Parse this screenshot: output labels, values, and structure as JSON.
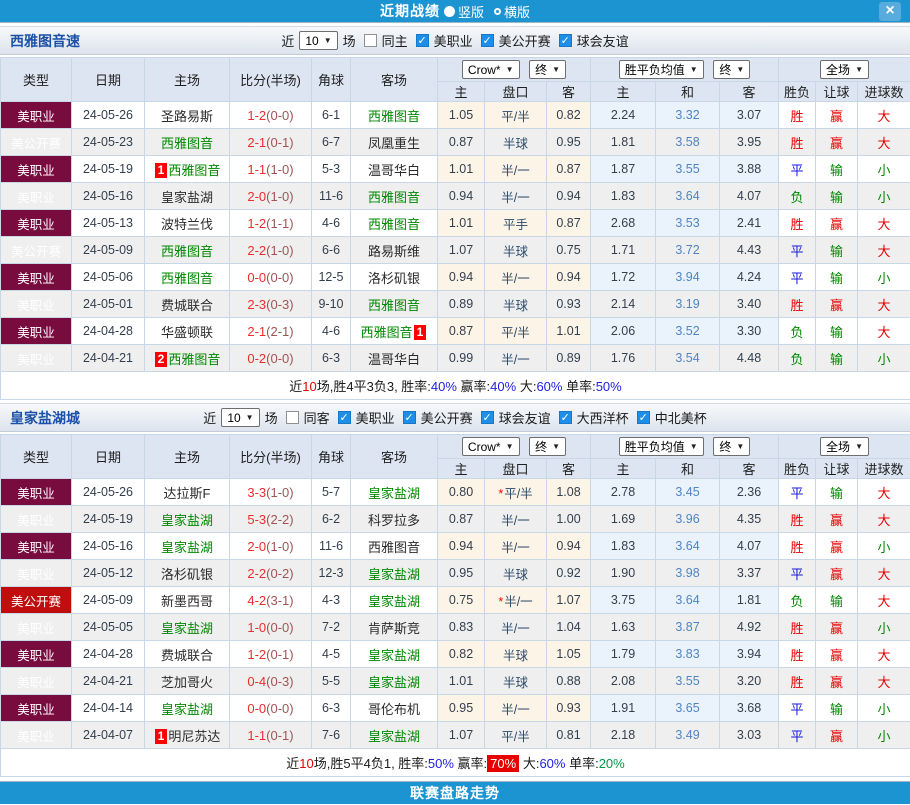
{
  "topbar": {
    "title": "近期战绩",
    "radios": [
      {
        "label": "竖版",
        "selected": true
      },
      {
        "label": "横版",
        "selected": false
      }
    ],
    "close": "×"
  },
  "header_labels": {
    "cols": [
      "类型",
      "日期",
      "主场",
      "比分(半场)",
      "角球",
      "客场"
    ],
    "sub": [
      "主",
      "盘口",
      "客",
      "主",
      "和",
      "客",
      "胜负",
      "让球",
      "进球数"
    ],
    "selects": {
      "crow": "Crow*",
      "final": "终",
      "avg": "胜平负均值",
      "scope": "全场"
    }
  },
  "legend_colors": {
    "胜": "cr",
    "平": "cbl",
    "负": "cg",
    "赢": "cr",
    "输": "cg",
    "大": "cr",
    "小": "cg"
  },
  "accent_colors": {
    "topbar": "#1d94d2",
    "mls": "#780c3f",
    "usoc": "#c00d0d",
    "focus_team": "#008800",
    "highlight": "#e60000"
  },
  "sections": [
    {
      "team": "西雅图音速",
      "filter": {
        "near": "近",
        "count": "10",
        "games": "场",
        "same": {
          "label": "同主",
          "checked": false
        },
        "leagues": [
          {
            "label": "美职业",
            "checked": true
          },
          {
            "label": "美公开赛",
            "checked": true
          },
          {
            "label": "球会友谊",
            "checked": true
          }
        ]
      },
      "rows": [
        {
          "league": "美职业",
          "lc": "mls",
          "date": "24-05-26",
          "home": {
            "name": "圣路易斯"
          },
          "score": {
            "ft": "1-2",
            "ht": "(0-0)"
          },
          "corners": "6-1",
          "away": {
            "name": "西雅图音",
            "focus": true
          },
          "asian": {
            "home": "1.05",
            "line": "平/半",
            "away": "0.82"
          },
          "avg": {
            "home": "2.24",
            "draw": "3.32",
            "away": "3.07"
          },
          "result": {
            "outcome": "胜",
            "handicap": "赢",
            "goals": "大"
          }
        },
        {
          "league": "美公开赛",
          "lc": "usoc",
          "date": "24-05-23",
          "home": {
            "name": "西雅图音",
            "focus": true
          },
          "score": {
            "ft": "2-1",
            "ht": "(0-1)"
          },
          "corners": "6-7",
          "away": {
            "name": "凤凰重生"
          },
          "asian": {
            "home": "0.87",
            "line": "半球",
            "away": "0.95"
          },
          "avg": {
            "home": "1.81",
            "draw": "3.58",
            "away": "3.95"
          },
          "result": {
            "outcome": "胜",
            "handicap": "赢",
            "goals": "大"
          }
        },
        {
          "league": "美职业",
          "lc": "mls",
          "date": "24-05-19",
          "home": {
            "name": "西雅图音",
            "focus": true,
            "badge": "1",
            "badge_pos": "before"
          },
          "score": {
            "ft": "1-1",
            "ht": "(1-0)"
          },
          "corners": "5-3",
          "away": {
            "name": "温哥华白"
          },
          "asian": {
            "home": "1.01",
            "line": "半/一",
            "away": "0.87"
          },
          "avg": {
            "home": "1.87",
            "draw": "3.55",
            "away": "3.88"
          },
          "result": {
            "outcome": "平",
            "handicap": "输",
            "goals": "小"
          }
        },
        {
          "league": "美职业",
          "lc": "mls",
          "date": "24-05-16",
          "home": {
            "name": "皇家盐湖"
          },
          "score": {
            "ft": "2-0",
            "ht": "(1-0)"
          },
          "corners": "11-6",
          "away": {
            "name": "西雅图音",
            "focus": true
          },
          "asian": {
            "home": "0.94",
            "line": "半/一",
            "away": "0.94"
          },
          "avg": {
            "home": "1.83",
            "draw": "3.64",
            "away": "4.07"
          },
          "result": {
            "outcome": "负",
            "handicap": "输",
            "goals": "小"
          }
        },
        {
          "league": "美职业",
          "lc": "mls",
          "date": "24-05-13",
          "home": {
            "name": "波特兰伐"
          },
          "score": {
            "ft": "1-2",
            "ht": "(1-1)"
          },
          "corners": "4-6",
          "away": {
            "name": "西雅图音",
            "focus": true
          },
          "asian": {
            "home": "1.01",
            "line": "平手",
            "away": "0.87"
          },
          "avg": {
            "home": "2.68",
            "draw": "3.53",
            "away": "2.41"
          },
          "result": {
            "outcome": "胜",
            "handicap": "赢",
            "goals": "大"
          }
        },
        {
          "league": "美公开赛",
          "lc": "usoc",
          "date": "24-05-09",
          "home": {
            "name": "西雅图音",
            "focus": true
          },
          "score": {
            "ft": "2-2",
            "ht": "(1-0)"
          },
          "corners": "6-6",
          "away": {
            "name": "路易斯维"
          },
          "asian": {
            "home": "1.07",
            "line": "半球",
            "away": "0.75"
          },
          "avg": {
            "home": "1.71",
            "draw": "3.72",
            "away": "4.43"
          },
          "result": {
            "outcome": "平",
            "handicap": "输",
            "goals": "大"
          }
        },
        {
          "league": "美职业",
          "lc": "mls",
          "date": "24-05-06",
          "home": {
            "name": "西雅图音",
            "focus": true
          },
          "score": {
            "ft": "0-0",
            "ht": "(0-0)"
          },
          "corners": "12-5",
          "away": {
            "name": "洛杉矶银"
          },
          "asian": {
            "home": "0.94",
            "line": "半/一",
            "away": "0.94"
          },
          "avg": {
            "home": "1.72",
            "draw": "3.94",
            "away": "4.24"
          },
          "result": {
            "outcome": "平",
            "handicap": "输",
            "goals": "小"
          }
        },
        {
          "league": "美职业",
          "lc": "mls",
          "date": "24-05-01",
          "home": {
            "name": "费城联合"
          },
          "score": {
            "ft": "2-3",
            "ht": "(0-3)"
          },
          "corners": "9-10",
          "away": {
            "name": "西雅图音",
            "focus": true
          },
          "asian": {
            "home": "0.89",
            "line": "半球",
            "away": "0.93"
          },
          "avg": {
            "home": "2.14",
            "draw": "3.19",
            "away": "3.40"
          },
          "result": {
            "outcome": "胜",
            "handicap": "赢",
            "goals": "大"
          }
        },
        {
          "league": "美职业",
          "lc": "mls",
          "date": "24-04-28",
          "home": {
            "name": "华盛顿联"
          },
          "score": {
            "ft": "2-1",
            "ht": "(2-1)"
          },
          "corners": "4-6",
          "away": {
            "name": "西雅图音",
            "focus": true,
            "badge": "1",
            "badge_pos": "after"
          },
          "asian": {
            "home": "0.87",
            "line": "平/半",
            "away": "1.01"
          },
          "avg": {
            "home": "2.06",
            "draw": "3.52",
            "away": "3.30"
          },
          "result": {
            "outcome": "负",
            "handicap": "输",
            "goals": "大"
          }
        },
        {
          "league": "美职业",
          "lc": "mls",
          "date": "24-04-21",
          "home": {
            "name": "西雅图音",
            "focus": true,
            "badge": "2",
            "badge_pos": "before"
          },
          "score": {
            "ft": "0-2",
            "ht": "(0-0)"
          },
          "corners": "6-3",
          "away": {
            "name": "温哥华白"
          },
          "asian": {
            "home": "0.99",
            "line": "半/一",
            "away": "0.89"
          },
          "avg": {
            "home": "1.76",
            "draw": "3.54",
            "away": "4.48"
          },
          "result": {
            "outcome": "负",
            "handicap": "输",
            "goals": "小"
          }
        }
      ],
      "summary": [
        {
          "t": "近",
          "c": "k"
        },
        {
          "t": "10",
          "c": "r"
        },
        {
          "t": "场,胜4平3负3, 胜率:",
          "c": "k"
        },
        {
          "t": "40%",
          "c": "b"
        },
        {
          "t": " 赢率:",
          "c": "k"
        },
        {
          "t": "40%",
          "c": "b"
        },
        {
          "t": " 大:",
          "c": "k"
        },
        {
          "t": "60%",
          "c": "b"
        },
        {
          "t": " 单率:",
          "c": "k"
        },
        {
          "t": "50%",
          "c": "b"
        }
      ]
    },
    {
      "team": "皇家盐湖城",
      "filter": {
        "near": "近",
        "count": "10",
        "games": "场",
        "same": {
          "label": "同客",
          "checked": false
        },
        "leagues": [
          {
            "label": "美职业",
            "checked": true
          },
          {
            "label": "美公开赛",
            "checked": true
          },
          {
            "label": "球会友谊",
            "checked": true
          },
          {
            "label": "大西洋杯",
            "checked": true
          },
          {
            "label": "中北美杯",
            "checked": true
          }
        ]
      },
      "rows": [
        {
          "league": "美职业",
          "lc": "mls",
          "date": "24-05-26",
          "home": {
            "name": "达拉斯F"
          },
          "score": {
            "ft": "3-3",
            "ht": "(1-0)"
          },
          "corners": "5-7",
          "away": {
            "name": "皇家盐湖",
            "focus": true
          },
          "asian": {
            "home": "0.80",
            "line": "平/半",
            "star": true,
            "away": "1.08"
          },
          "avg": {
            "home": "2.78",
            "draw": "3.45",
            "away": "2.36"
          },
          "result": {
            "outcome": "平",
            "handicap": "输",
            "goals": "大"
          }
        },
        {
          "league": "美职业",
          "lc": "mls",
          "date": "24-05-19",
          "home": {
            "name": "皇家盐湖",
            "focus": true
          },
          "score": {
            "ft": "5-3",
            "ht": "(2-2)"
          },
          "corners": "6-2",
          "away": {
            "name": "科罗拉多"
          },
          "asian": {
            "home": "0.87",
            "line": "半/一",
            "away": "1.00"
          },
          "avg": {
            "home": "1.69",
            "draw": "3.96",
            "away": "4.35"
          },
          "result": {
            "outcome": "胜",
            "handicap": "赢",
            "goals": "大"
          }
        },
        {
          "league": "美职业",
          "lc": "mls",
          "date": "24-05-16",
          "home": {
            "name": "皇家盐湖",
            "focus": true
          },
          "score": {
            "ft": "2-0",
            "ht": "(1-0)"
          },
          "corners": "11-6",
          "away": {
            "name": "西雅图音"
          },
          "asian": {
            "home": "0.94",
            "line": "半/一",
            "away": "0.94"
          },
          "avg": {
            "home": "1.83",
            "draw": "3.64",
            "away": "4.07"
          },
          "result": {
            "outcome": "胜",
            "handicap": "赢",
            "goals": "小"
          }
        },
        {
          "league": "美职业",
          "lc": "mls",
          "date": "24-05-12",
          "home": {
            "name": "洛杉矶银"
          },
          "score": {
            "ft": "2-2",
            "ht": "(0-2)"
          },
          "corners": "12-3",
          "away": {
            "name": "皇家盐湖",
            "focus": true
          },
          "asian": {
            "home": "0.95",
            "line": "半球",
            "away": "0.92"
          },
          "avg": {
            "home": "1.90",
            "draw": "3.98",
            "away": "3.37"
          },
          "result": {
            "outcome": "平",
            "handicap": "赢",
            "goals": "大"
          }
        },
        {
          "league": "美公开赛",
          "lc": "usoc",
          "date": "24-05-09",
          "home": {
            "name": "新墨西哥"
          },
          "score": {
            "ft": "4-2",
            "ht": "(3-1)"
          },
          "corners": "4-3",
          "away": {
            "name": "皇家盐湖",
            "focus": true
          },
          "asian": {
            "home": "0.75",
            "line": "半/一",
            "star": true,
            "away": "1.07"
          },
          "avg": {
            "home": "3.75",
            "draw": "3.64",
            "away": "1.81"
          },
          "result": {
            "outcome": "负",
            "handicap": "输",
            "goals": "大"
          }
        },
        {
          "league": "美职业",
          "lc": "mls",
          "date": "24-05-05",
          "home": {
            "name": "皇家盐湖",
            "focus": true
          },
          "score": {
            "ft": "1-0",
            "ht": "(0-0)"
          },
          "corners": "7-2",
          "away": {
            "name": "肯萨斯竞"
          },
          "asian": {
            "home": "0.83",
            "line": "半/一",
            "away": "1.04"
          },
          "avg": {
            "home": "1.63",
            "draw": "3.87",
            "away": "4.92"
          },
          "result": {
            "outcome": "胜",
            "handicap": "赢",
            "goals": "小"
          }
        },
        {
          "league": "美职业",
          "lc": "mls",
          "date": "24-04-28",
          "home": {
            "name": "费城联合"
          },
          "score": {
            "ft": "1-2",
            "ht": "(0-1)"
          },
          "corners": "4-5",
          "away": {
            "name": "皇家盐湖",
            "focus": true
          },
          "asian": {
            "home": "0.82",
            "line": "半球",
            "away": "1.05"
          },
          "avg": {
            "home": "1.79",
            "draw": "3.83",
            "away": "3.94"
          },
          "result": {
            "outcome": "胜",
            "handicap": "赢",
            "goals": "大"
          }
        },
        {
          "league": "美职业",
          "lc": "mls",
          "date": "24-04-21",
          "home": {
            "name": "芝加哥火"
          },
          "score": {
            "ft": "0-4",
            "ht": "(0-3)"
          },
          "corners": "5-5",
          "away": {
            "name": "皇家盐湖",
            "focus": true
          },
          "asian": {
            "home": "1.01",
            "line": "半球",
            "away": "0.88"
          },
          "avg": {
            "home": "2.08",
            "draw": "3.55",
            "away": "3.20"
          },
          "result": {
            "outcome": "胜",
            "handicap": "赢",
            "goals": "大"
          }
        },
        {
          "league": "美职业",
          "lc": "mls",
          "date": "24-04-14",
          "home": {
            "name": "皇家盐湖",
            "focus": true
          },
          "score": {
            "ft": "0-0",
            "ht": "(0-0)"
          },
          "corners": "6-3",
          "away": {
            "name": "哥伦布机"
          },
          "asian": {
            "home": "0.95",
            "line": "半/一",
            "away": "0.93"
          },
          "avg": {
            "home": "1.91",
            "draw": "3.65",
            "away": "3.68"
          },
          "result": {
            "outcome": "平",
            "handicap": "输",
            "goals": "小"
          }
        },
        {
          "league": "美职业",
          "lc": "mls",
          "date": "24-04-07",
          "home": {
            "name": "明尼苏达",
            "badge": "1",
            "badge_pos": "before"
          },
          "score": {
            "ft": "1-1",
            "ht": "(0-1)"
          },
          "corners": "7-6",
          "away": {
            "name": "皇家盐湖",
            "focus": true
          },
          "asian": {
            "home": "1.07",
            "line": "平/半",
            "away": "0.81"
          },
          "avg": {
            "home": "2.18",
            "draw": "3.49",
            "away": "3.03"
          },
          "result": {
            "outcome": "平",
            "handicap": "赢",
            "goals": "小"
          }
        }
      ],
      "summary": [
        {
          "t": "近",
          "c": "k"
        },
        {
          "t": "10",
          "c": "r"
        },
        {
          "t": "场,胜5平4负1, 胜率:",
          "c": "k"
        },
        {
          "t": "50%",
          "c": "b"
        },
        {
          "t": " 赢率:",
          "c": "k"
        },
        {
          "t": "70%",
          "c": "hl"
        },
        {
          "t": " 大:",
          "c": "k"
        },
        {
          "t": "60%",
          "c": "b"
        },
        {
          "t": " 单率:",
          "c": "k"
        },
        {
          "t": "20%",
          "c": "g"
        }
      ]
    }
  ],
  "footer": {
    "label": "联赛盘路走势"
  }
}
